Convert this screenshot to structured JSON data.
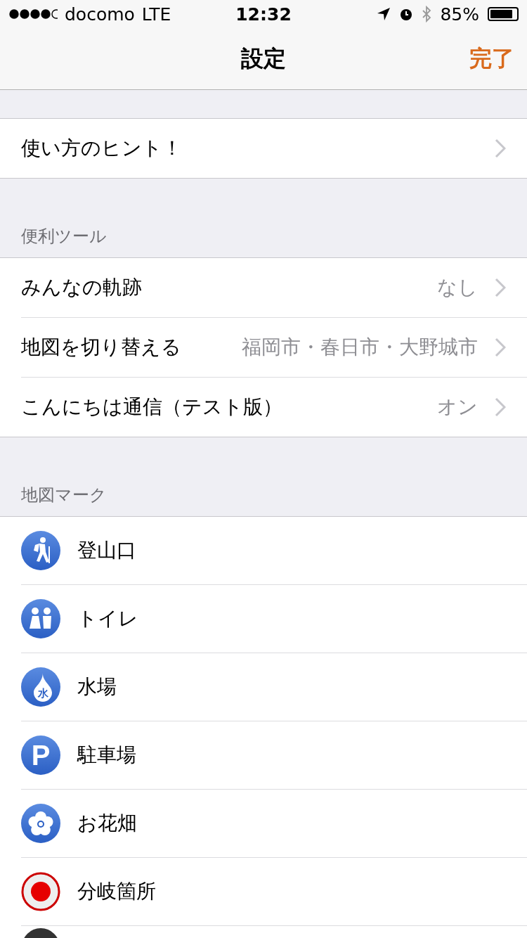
{
  "status_bar": {
    "carrier": "docomo",
    "network": "LTE",
    "time": "12:32",
    "battery_text": "85%"
  },
  "nav": {
    "title": "設定",
    "done": "完了"
  },
  "hint_row": {
    "label": "使い方のヒント！"
  },
  "sections": [
    {
      "header": "便利ツール",
      "rows": [
        {
          "label": "みんなの軌跡",
          "value": "なし"
        },
        {
          "label": "地図を切り替える",
          "value": "福岡市・春日市・大野城市"
        },
        {
          "label": "こんにちは通信（テスト版）",
          "value": "オン"
        }
      ]
    }
  ],
  "map_marks": {
    "header": "地図マーク",
    "items": [
      {
        "kind": "hiker",
        "label": "登山口"
      },
      {
        "kind": "toilet",
        "label": "トイレ"
      },
      {
        "kind": "water",
        "label": "水場",
        "glyph": "水"
      },
      {
        "kind": "parking",
        "label": "駐車場",
        "glyph": "P"
      },
      {
        "kind": "flower",
        "label": "お花畑"
      },
      {
        "kind": "junction",
        "label": "分岐箇所"
      },
      {
        "kind": "dark"
      }
    ]
  }
}
